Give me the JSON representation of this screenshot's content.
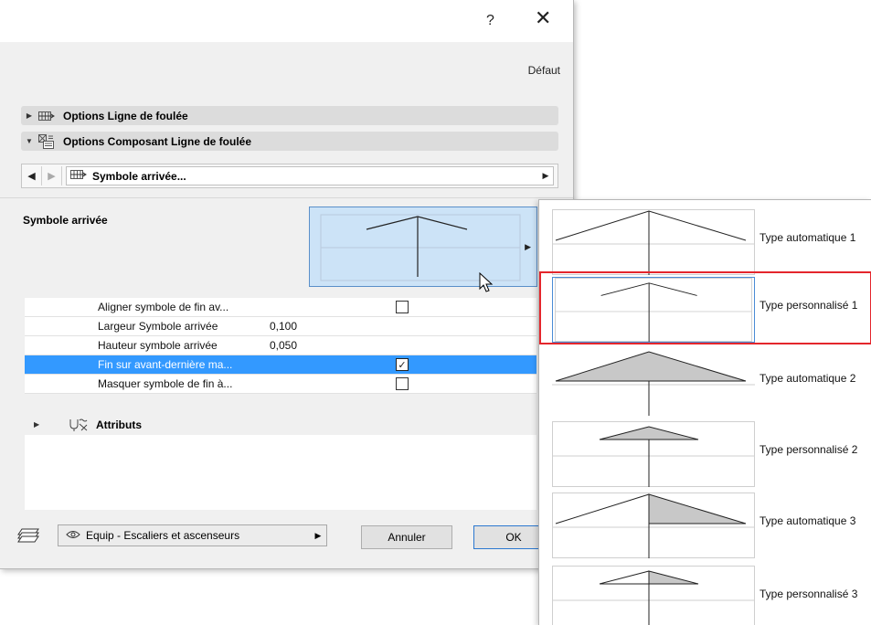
{
  "titlebar": {
    "help_label": "?",
    "close_label": "✕"
  },
  "defaut_label": "Défaut",
  "sections": [
    {
      "label": "Options Ligne de foulée",
      "expanded": false
    },
    {
      "label": "Options Composant Ligne de foulée",
      "expanded": true
    }
  ],
  "nav": {
    "selected": "Symbole arrivée..."
  },
  "symbol": {
    "label": "Symbole arrivée"
  },
  "params": [
    {
      "name": "Aligner symbole de fin av...",
      "value": "",
      "checkbox": true,
      "checked": false,
      "selected": false
    },
    {
      "name": "Largeur Symbole arrivée",
      "value": "0,100",
      "checkbox": false,
      "selected": false
    },
    {
      "name": "Hauteur symbole arrivée",
      "value": "0,050",
      "checkbox": false,
      "selected": false
    },
    {
      "name": "Fin sur avant-dernière ma...",
      "value": "",
      "checkbox": true,
      "checked": true,
      "selected": true
    },
    {
      "name": "Masquer symbole de fin à...",
      "value": "",
      "checkbox": true,
      "checked": false,
      "selected": false
    }
  ],
  "attributes_label": "Attributs",
  "footer": {
    "layer": "Equip - Escaliers et ascenseurs",
    "cancel_label": "Annuler",
    "ok_label": "OK"
  },
  "popup_items": [
    {
      "label": "Type automatique 1",
      "style": "open-wide"
    },
    {
      "label": "Type personnalisé 1",
      "style": "open-small",
      "highlighted": true
    },
    {
      "label": "Type automatique 2",
      "style": "filled-wide"
    },
    {
      "label": "Type personnalisé 2",
      "style": "filled-small"
    },
    {
      "label": "Type automatique 3",
      "style": "half-wide"
    },
    {
      "label": "Type personnalisé 3",
      "style": "half-small"
    }
  ],
  "colors": {
    "selection": "#3399ff",
    "highlight_outline": "#e4262c",
    "preview_bg": "#cce3f7"
  }
}
